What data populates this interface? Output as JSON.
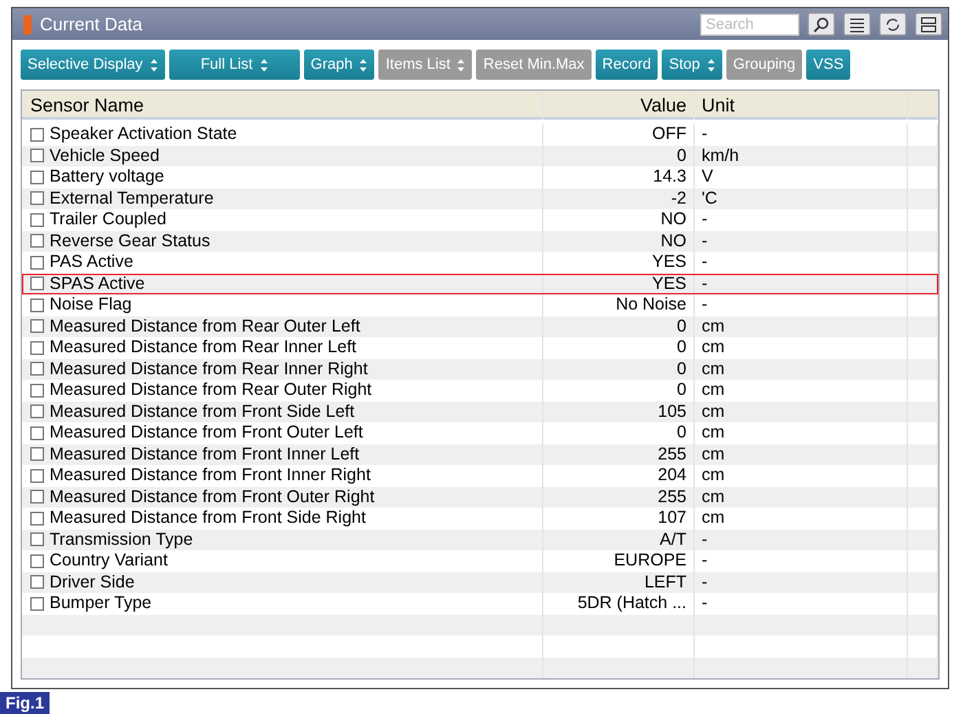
{
  "window": {
    "title": "Current Data"
  },
  "search": {
    "placeholder": "Search"
  },
  "toolbar": [
    {
      "label": "Selective Display",
      "dropdown": true,
      "disabled": false
    },
    {
      "label": "Full List",
      "dropdown": true,
      "disabled": false
    },
    {
      "label": "Graph",
      "dropdown": true,
      "disabled": false
    },
    {
      "label": "Items List",
      "dropdown": true,
      "disabled": true
    },
    {
      "label": "Reset Min.Max",
      "dropdown": false,
      "disabled": true
    },
    {
      "label": "Record",
      "dropdown": false,
      "disabled": false
    },
    {
      "label": "Stop",
      "dropdown": true,
      "disabled": false
    },
    {
      "label": "Grouping",
      "dropdown": false,
      "disabled": true
    },
    {
      "label": "VSS",
      "dropdown": false,
      "disabled": false
    }
  ],
  "table": {
    "columns": [
      "Sensor Name",
      "Value",
      "Unit"
    ],
    "rows": [
      {
        "name": "Speaker Activation State",
        "value": "OFF",
        "unit": "-",
        "checked": false,
        "highlighted": false
      },
      {
        "name": "Vehicle Speed",
        "value": "0",
        "unit": "km/h",
        "checked": false,
        "highlighted": false
      },
      {
        "name": "Battery voltage",
        "value": "14.3",
        "unit": "V",
        "checked": false,
        "highlighted": false
      },
      {
        "name": "External Temperature",
        "value": "-2",
        "unit": "'C",
        "checked": false,
        "highlighted": false
      },
      {
        "name": "Trailer Coupled",
        "value": "NO",
        "unit": "-",
        "checked": false,
        "highlighted": false
      },
      {
        "name": "Reverse Gear Status",
        "value": "NO",
        "unit": "-",
        "checked": false,
        "highlighted": false
      },
      {
        "name": "PAS Active",
        "value": "YES",
        "unit": "-",
        "checked": false,
        "highlighted": false
      },
      {
        "name": "SPAS Active",
        "value": "YES",
        "unit": "-",
        "checked": false,
        "highlighted": true
      },
      {
        "name": "Noise Flag",
        "value": "No Noise",
        "unit": "-",
        "checked": false,
        "highlighted": false
      },
      {
        "name": "Measured Distance from Rear Outer Left",
        "value": "0",
        "unit": "cm",
        "checked": false,
        "highlighted": false
      },
      {
        "name": "Measured Distance from Rear Inner Left",
        "value": "0",
        "unit": "cm",
        "checked": false,
        "highlighted": false
      },
      {
        "name": "Measured Distance from Rear Inner Right",
        "value": "0",
        "unit": "cm",
        "checked": false,
        "highlighted": false
      },
      {
        "name": "Measured Distance from Rear Outer Right",
        "value": "0",
        "unit": "cm",
        "checked": false,
        "highlighted": false
      },
      {
        "name": "Measured Distance from Front Side Left",
        "value": "105",
        "unit": "cm",
        "checked": false,
        "highlighted": false
      },
      {
        "name": "Measured Distance from Front Outer Left",
        "value": "0",
        "unit": "cm",
        "checked": false,
        "highlighted": false
      },
      {
        "name": "Measured Distance from Front Inner Left",
        "value": "255",
        "unit": "cm",
        "checked": false,
        "highlighted": false
      },
      {
        "name": "Measured Distance from Front Inner Right",
        "value": "204",
        "unit": "cm",
        "checked": false,
        "highlighted": false
      },
      {
        "name": "Measured Distance from Front Outer Right",
        "value": "255",
        "unit": "cm",
        "checked": false,
        "highlighted": false
      },
      {
        "name": "Measured Distance from Front Side Right",
        "value": "107",
        "unit": "cm",
        "checked": false,
        "highlighted": false
      },
      {
        "name": "Transmission Type",
        "value": "A/T",
        "unit": "-",
        "checked": false,
        "highlighted": false
      },
      {
        "name": "Country Variant",
        "value": "EUROPE",
        "unit": "-",
        "checked": false,
        "highlighted": false
      },
      {
        "name": "Driver Side",
        "value": "LEFT",
        "unit": "-",
        "checked": false,
        "highlighted": false
      },
      {
        "name": "Bumper Type",
        "value": "5DR (Hatch ...",
        "unit": "-",
        "checked": false,
        "highlighted": false
      }
    ]
  },
  "figure_label": "Fig.1"
}
